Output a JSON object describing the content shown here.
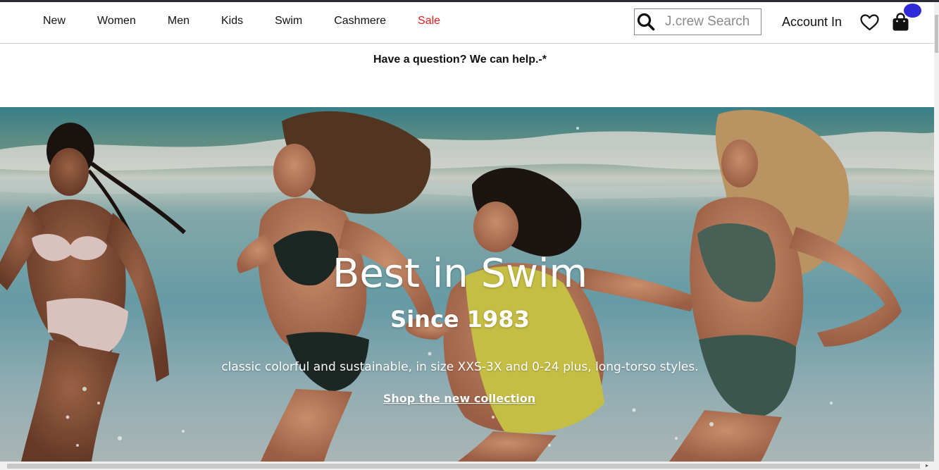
{
  "header": {
    "nav": [
      {
        "label": "New"
      },
      {
        "label": "Women"
      },
      {
        "label": "Men"
      },
      {
        "label": "Kids"
      },
      {
        "label": "Swim"
      },
      {
        "label": "Cashmere"
      },
      {
        "label": "Sale",
        "color": "#e41d1d"
      }
    ],
    "search": {
      "placeholder": "J.crew Search",
      "icon": "search-icon"
    },
    "account_label": "Account In",
    "wishlist_icon": "heart-icon",
    "bag_icon": "shopping-bag-icon",
    "badge_color": "#2f2bd8"
  },
  "help": {
    "text": "Have a question? We can help.-*"
  },
  "hero": {
    "title": "Best in Swim",
    "subtitle": "Since 1983",
    "description": "classic colorful and sustainable, in size XXS-3X and 0-24 plus, long-torso styles.",
    "cta_label": "Shop the new collection",
    "image": "four-women-running-in-swimsuits-at-beach-photo"
  }
}
